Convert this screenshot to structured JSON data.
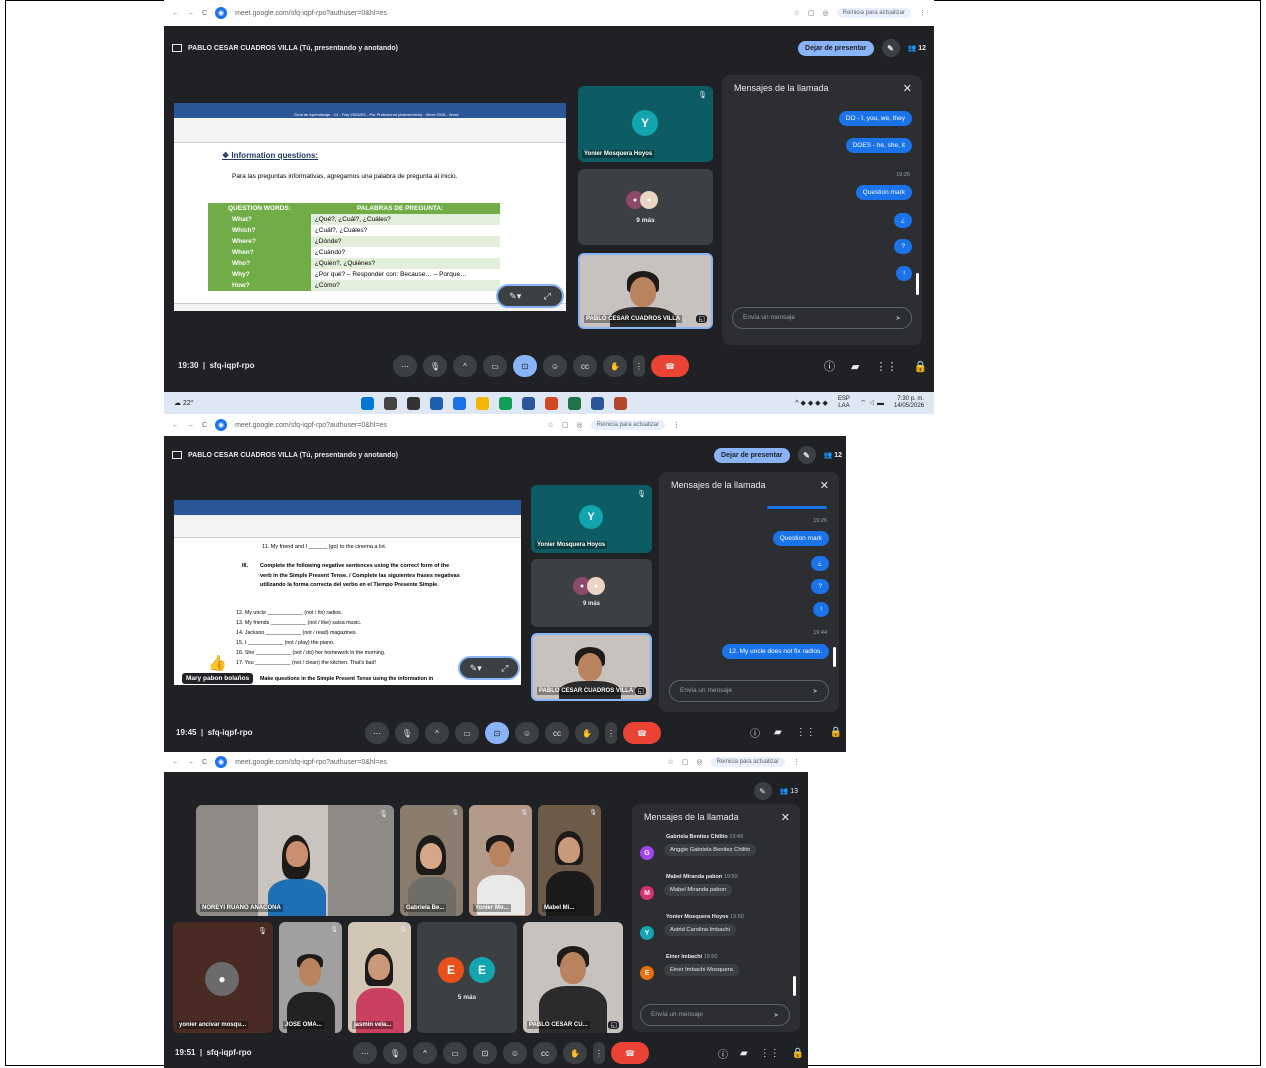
{
  "shot1": {
    "url": "meet.google.com/sfq-iqpf-rpo?authuser=0&hl=es",
    "update_label": "Reinicia para actualizar",
    "presenter_title": "PABLO CESAR CUADROS VILLA (Tú, presentando y anotando)",
    "stop_presenting": "Dejar de presentar",
    "participants_count": "12",
    "chat_title": "Mensajes de la llamada",
    "messages": [
      "DO - I, you, we, they",
      "DOES - he, she, it",
      "Question mark",
      "¿",
      "?",
      "!"
    ],
    "time_stamp": "19:26",
    "chat_placeholder": "Envía un mensaje",
    "tiles": {
      "yonier_initial": "Y",
      "yonier_name": "Yonier Mosquera Hoyos",
      "more": "9 más",
      "self_name": "PABLO CESAR CUADROS VILLA"
    },
    "meeting_time": "19:30",
    "meeting_code": "sfq-iqpf-rpo",
    "doc": {
      "ribbon_title": "Guía de Aprendizaje - 14 - Fidy 2024/ES - Por Profesional (Autoservicio) - Word 2016 - Word",
      "heading": "Information questions:",
      "intro": "Para las preguntas informativas, agregamos una palabra de pregunta al inicio.",
      "col1": "QUESTION WORDS:",
      "col2": "PALABRAS DE PREGUNTA:",
      "rows": [
        [
          "What?",
          "¿Qué?, ¿Cuál?, ¿Cuáles?"
        ],
        [
          "Which?",
          "¿Cuál?, ¿Cuáles?"
        ],
        [
          "Where?",
          "¿Dónde?"
        ],
        [
          "When?",
          "¿Cuándo?"
        ],
        [
          "Who?",
          "¿Quién?, ¿Quiénes?"
        ],
        [
          "Why?",
          "¿Por qué? – Responder con: Because… – Porque…"
        ],
        [
          "How?",
          "¿Cómo?"
        ]
      ]
    },
    "taskbar": {
      "temp": "22°",
      "lang1": "ESP",
      "lang2": "LAA",
      "clock": "7:30 p. m.",
      "date": "14/05/2026"
    }
  },
  "shot2": {
    "url": "meet.google.com/sfq-iqpf-rpo?authuser=0&hl=es",
    "update_label": "Reinicia para actualizar",
    "presenter_title": "PABLO CESAR CUADROS VILLA (Tú, presentando y anotando)",
    "stop_presenting": "Dejar de presentar",
    "participants_count": "12",
    "chat_title": "Mensajes de la llamada",
    "messages": [
      "Question mark",
      "¿",
      "?",
      "!",
      "12. My uncle does not fix radios."
    ],
    "times": [
      "19:26",
      "19:44"
    ],
    "chat_placeholder": "Envía un mensaje",
    "tiles": {
      "yonier_initial": "Y",
      "yonier_name": "Yonier Mosquera Hoyos",
      "more": "9 más",
      "self_name": "PABLO CESAR CUADROS VILLA",
      "raised": "Mary pabon bolaños"
    },
    "meeting_time": "19:45",
    "meeting_code": "sfq-iqpf-rpo",
    "doc": {
      "line11": "11. My friend and I ______ (go) to the cinema a lot.",
      "section": "III.",
      "instruction": "Complete the following negative sentences using the correct form of the verb in the Simple Present Tense. / Complete las siguientes frases negativas utilizando la forma correcta del verbo en el Tiempo Presente Simple.",
      "items": [
        "12. My uncle ____________ (not / fix) radios.",
        "13. My friends ____________ (not / like) salsa music.",
        "14. Jackson ____________ (not / read) magazines.",
        "15. I ____________ (not / play) the piano.",
        "16. She ____________ (not / do) her homework in the morning.",
        "17. You ____________ (not / clean) the kitchen. That's bad!"
      ],
      "cut_line": "Make questions in the Simple Present Tense using the information in"
    }
  },
  "shot3": {
    "url": "meet.google.com/sfq-iqpf-rpo?authuser=0&hl=es",
    "update_label": "Reinicia para actualizar",
    "participants_count": "13",
    "chat_title": "Mensajes de la llamada",
    "chat_entries": [
      {
        "sender": "Gabriela Benitez Chilito",
        "time": "19:49",
        "initial": "G",
        "color": "#a142f4",
        "text": "Anggie Gabriela Benitez Chilito"
      },
      {
        "sender": "Mabel Miranda pabon",
        "time": "19:50",
        "initial": "M",
        "color": "#d93070",
        "text": "Mabel Miranda pabon"
      },
      {
        "sender": "Yonier Mosquera Hoyos",
        "time": "19:50",
        "initial": "Y",
        "color": "#12a4af",
        "text": "Astrid Carolina Imbachi"
      },
      {
        "sender": "Einer Imbachi",
        "time": "19:50",
        "initial": "E",
        "color": "#e8710a",
        "text": "Einer Imbachi Mosquera"
      }
    ],
    "chat_placeholder": "Envía un mensaje",
    "tiles": {
      "big": "NOREYI RUANO ANACONA",
      "t2": "Gabriela Be...",
      "t3": "Yonier Mo...",
      "t4": "Mabel Mi...",
      "t5": "yonier ancivar mosqu...",
      "t6": "JOSE OMA...",
      "t7": "jasmin vela...",
      "more": "5 más",
      "e1": "E",
      "e2": "E",
      "self": "PABLO CESAR CU..."
    },
    "meeting_time": "19:51",
    "meeting_code": "sfq-iqpf-rpo"
  }
}
